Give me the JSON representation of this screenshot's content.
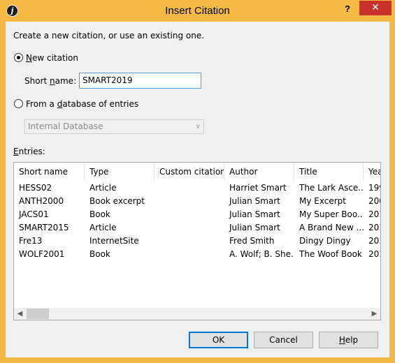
{
  "window": {
    "title": "Insert Citation",
    "app_icon_glyph": "j",
    "help_glyph": "?",
    "close_glyph": "✕",
    "accent": "#f5b944",
    "close_color": "#c7312a"
  },
  "intro": "Create a new citation, or use an existing one.",
  "new_citation": {
    "label": "New citation",
    "selected": true,
    "short_name_label": "Short name:",
    "short_name_value": "SMART2019"
  },
  "database": {
    "label": "From a database of entries",
    "selected": false,
    "combo_value": "Internal Database",
    "combo_icon": "chevron-down-icon"
  },
  "entries": {
    "label": "Entries:",
    "columns": [
      "Short name",
      "Type",
      "Custom citation",
      "Author",
      "Title",
      "Yea"
    ],
    "rows": [
      [
        "HESS02",
        "Article",
        "",
        "Harriet Smart",
        "The Lark Asce...",
        "199"
      ],
      [
        "ANTH2000",
        "Book excerpt",
        "",
        "Julian Smart",
        "My Excerpt",
        "200"
      ],
      [
        "JACS01",
        "Book",
        "",
        "Julian Smart",
        "My Super Boo...",
        "201"
      ],
      [
        "SMART2015",
        "Article",
        "",
        "Julian Smart",
        "A Brand New ...",
        "201"
      ],
      [
        "Fre13",
        "InternetSite",
        "",
        "Fred Smith",
        "Dingy Dingy",
        "201"
      ],
      [
        "WOLF2001",
        "Book",
        "",
        "A. Wolf; B. She...",
        "The Woof Book",
        "201"
      ]
    ],
    "scroll_left_glyph": "◀",
    "scroll_right_glyph": "▶"
  },
  "buttons": {
    "ok": "OK",
    "cancel": "Cancel",
    "help": "Help"
  }
}
